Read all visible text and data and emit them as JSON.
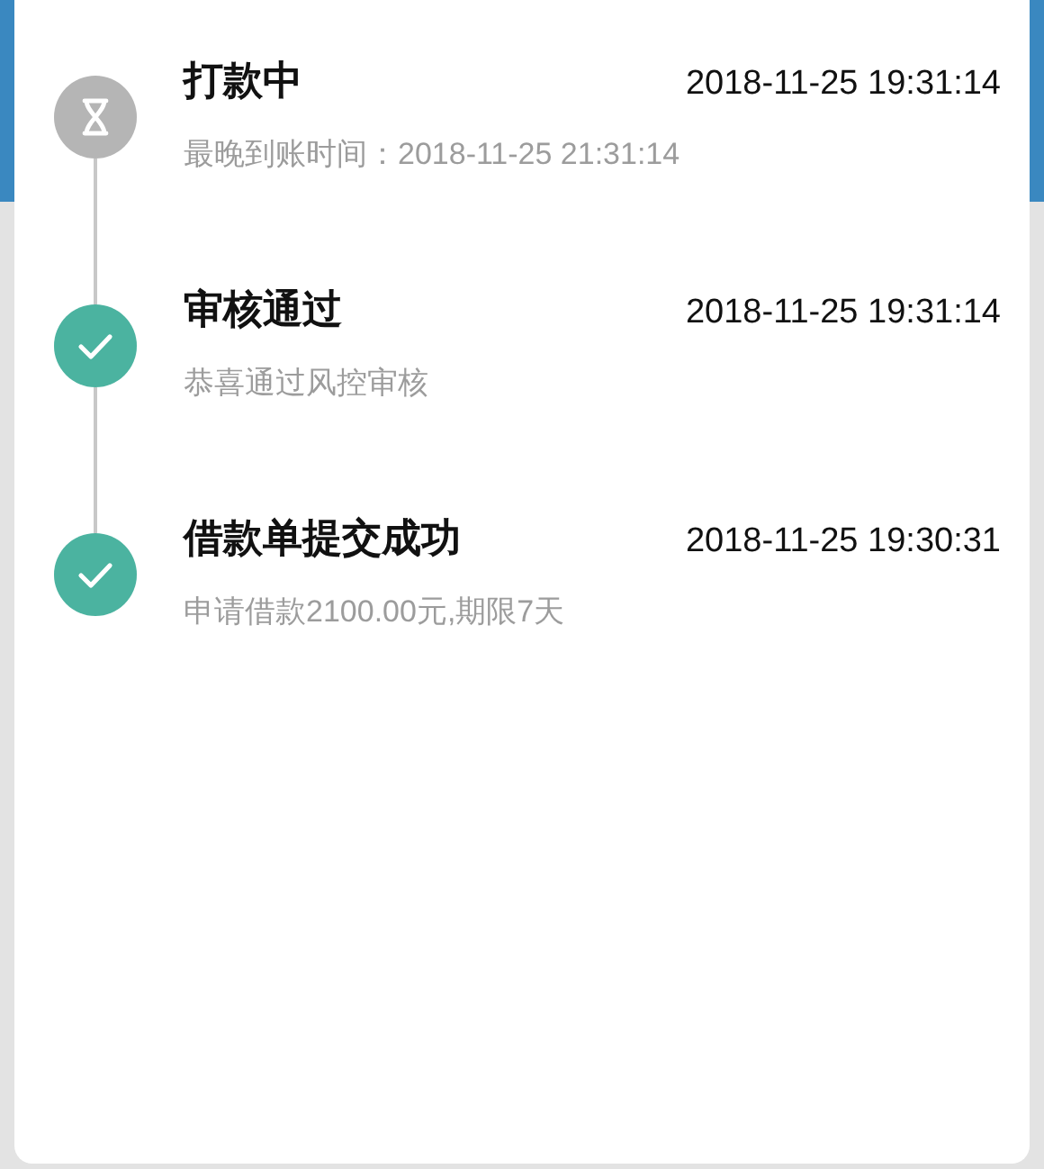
{
  "steps": [
    {
      "kind": "pending",
      "title": "打款中",
      "time": "2018-11-25 19:31:14",
      "detail": "最晚到账时间：2018-11-25 21:31:14"
    },
    {
      "kind": "done",
      "title": "审核通过",
      "time": "2018-11-25 19:31:14",
      "detail": "恭喜通过风控审核"
    },
    {
      "kind": "done",
      "title": "借款单提交成功",
      "time": "2018-11-25 19:30:31",
      "detail": "申请借款2100.00元,期限7天"
    }
  ]
}
